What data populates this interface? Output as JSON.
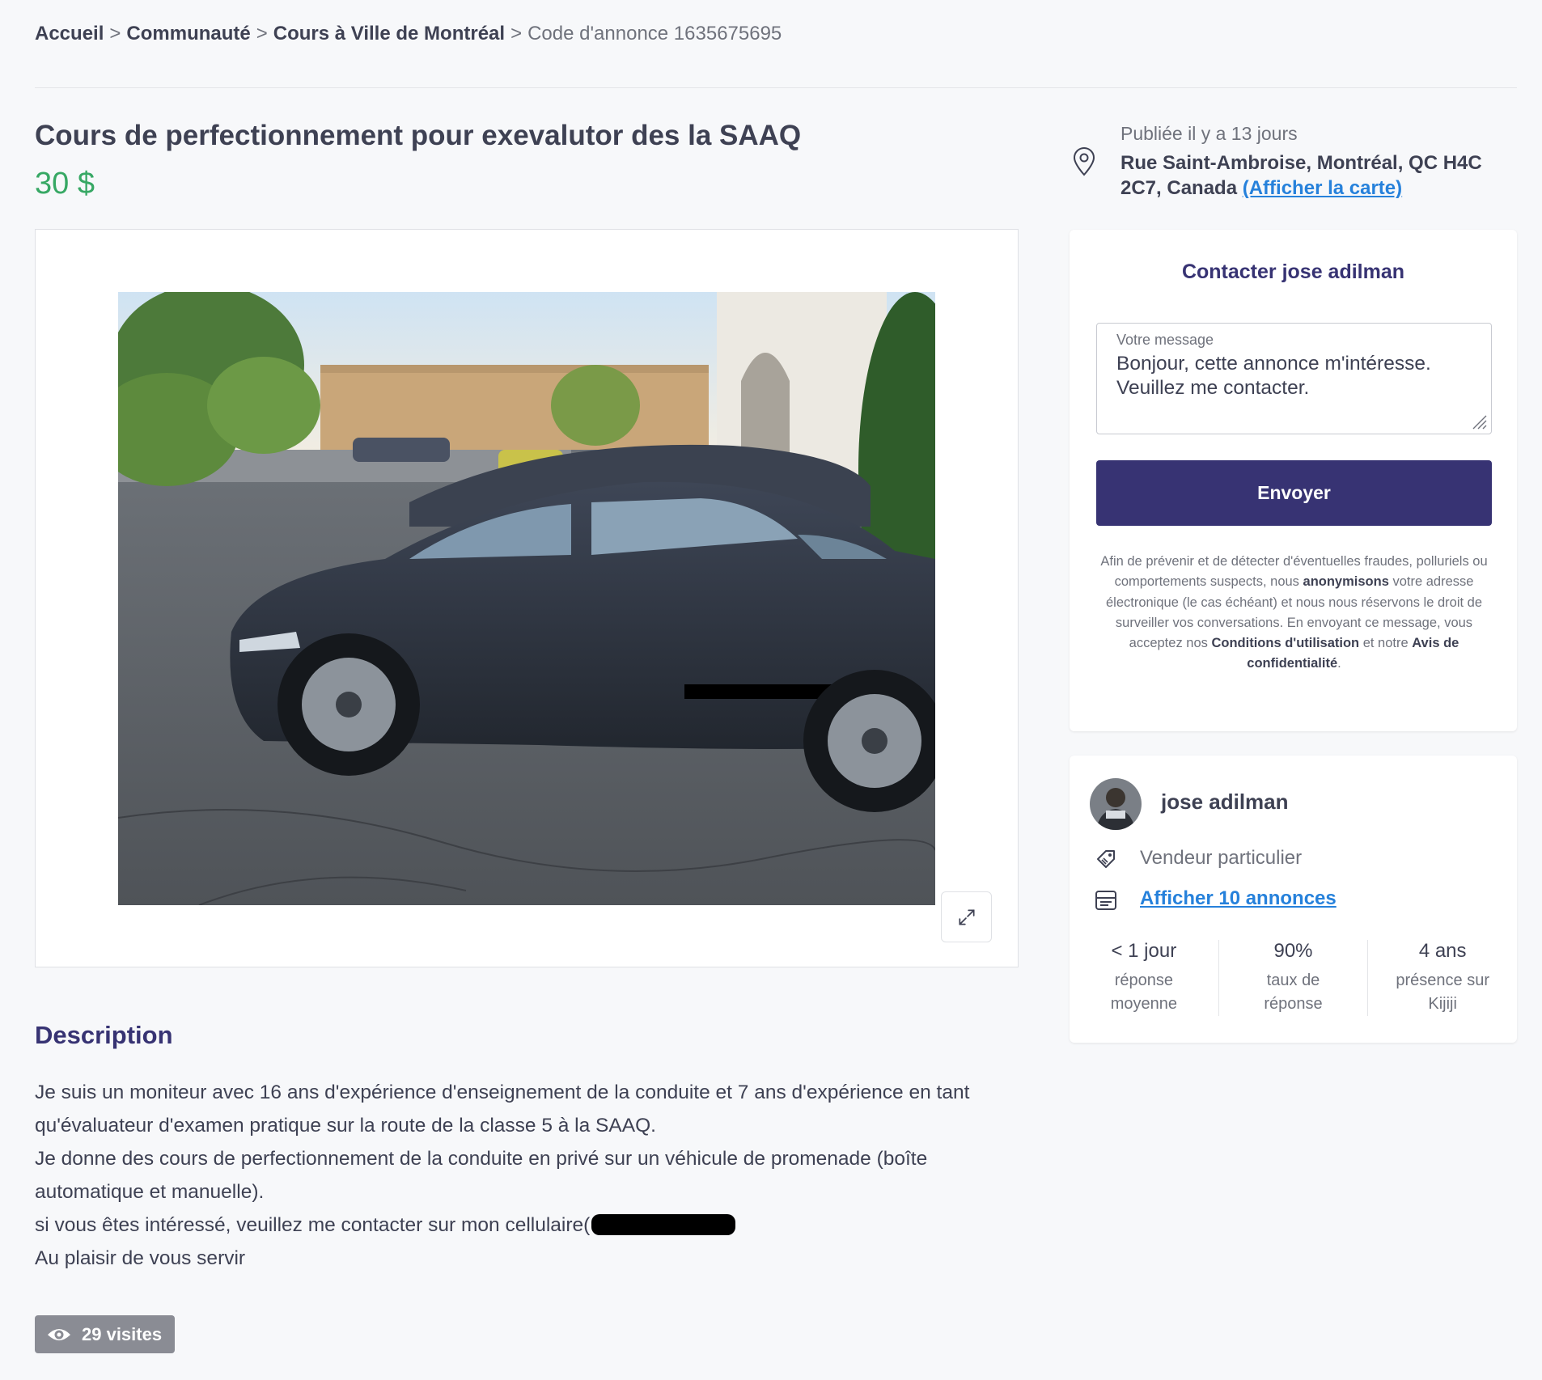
{
  "breadcrumb": {
    "items": [
      "Accueil",
      "Communauté",
      "Cours à Ville de Montréal"
    ],
    "separator": ">",
    "current": "Code d'annonce 1635675695"
  },
  "listing": {
    "title": "Cours de perfectionnement pour exevalutor des la SAAQ",
    "price": "30 $"
  },
  "location": {
    "published": "Publiée il y a 13 jours",
    "address": "Rue Saint-Ambroise, Montréal, QC H4C 2C7, Canada",
    "map_link": "(Afficher la carte)"
  },
  "contact": {
    "title": "Contacter jose adilman",
    "message_label": "Votre message",
    "message_value": "Bonjour, cette annonce m'intéresse. Veuillez me contacter.",
    "send_label": "Envoyer",
    "disclaimer": {
      "part1": "Afin de prévenir et de détecter d'éventuelles fraudes, polluriels ou comportements suspects, nous ",
      "bold1": "anonymisons",
      "part2": " votre adresse électronique (le cas échéant) et nous nous réservons le droit de surveiller vos conversations. En envoyant ce message, vous acceptez nos ",
      "bold2": "Conditions d'utilisation",
      "part3": " et notre ",
      "bold3": "Avis de confidentialité",
      "part4": "."
    }
  },
  "seller": {
    "name": "jose adilman",
    "type": "Vendeur particulier",
    "ads_link": "Afficher 10 annonces",
    "stats": [
      {
        "value": "< 1 jour",
        "label": "réponse moyenne"
      },
      {
        "value": "90%",
        "label": "taux de réponse"
      },
      {
        "value": "4 ans",
        "label": "présence sur Kijiji"
      }
    ]
  },
  "description": {
    "heading": "Description",
    "lines": [
      "Je suis un moniteur avec 16 ans d'expérience d'enseignement de la conduite et 7 ans d'expérience en tant",
      "qu'évaluateur d'examen pratique sur la route de la classe 5 à la SAAQ.",
      "Je donne des cours de perfectionnement de la conduite en privé sur un véhicule de promenade (boîte",
      "automatique et manuelle).",
      "si vous êtes intéressé, veuillez me contacter sur mon cellulaire(",
      "Au plaisir de vous servir"
    ]
  },
  "visits": "29 visites",
  "icons": {
    "location": "map-pin-icon",
    "expand": "expand-icon",
    "resize": "resize-handle-icon",
    "seller_type": "tag-icon",
    "ads": "listing-icon",
    "visits": "eye-icon"
  },
  "colors": {
    "primary": "#373373",
    "price": "#37a864",
    "link": "#2681db",
    "muted": "#6f727c"
  }
}
